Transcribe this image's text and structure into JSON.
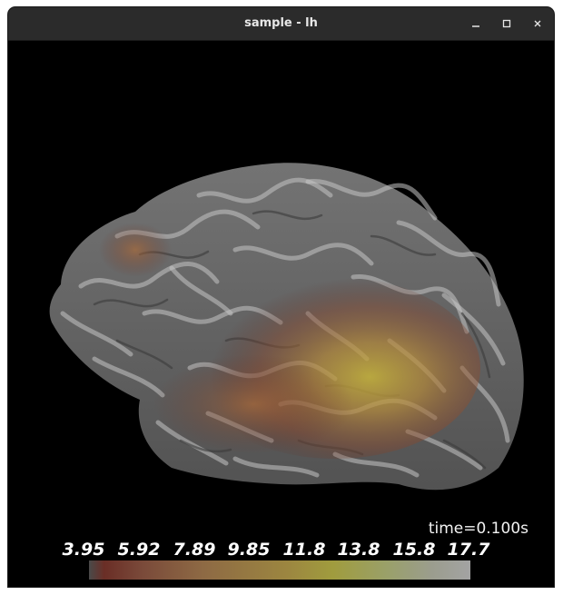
{
  "window": {
    "title": "sample - lh",
    "controls": {
      "minimize_icon": "minimize-icon",
      "maximize_icon": "maximize-icon",
      "close_icon": "close-icon"
    }
  },
  "viewer": {
    "time_label": "time=0.100s",
    "colorbar": {
      "ticks": [
        "3.95",
        "5.92",
        "7.89",
        "9.85",
        "11.8",
        "13.8",
        "15.8",
        "17.7"
      ],
      "min_color": "#4a4a4a",
      "mid_color": "#a09c3e",
      "max_color": "#a3a3a3"
    },
    "background_color": "#000000",
    "surface_color": "#8c8c8c"
  }
}
